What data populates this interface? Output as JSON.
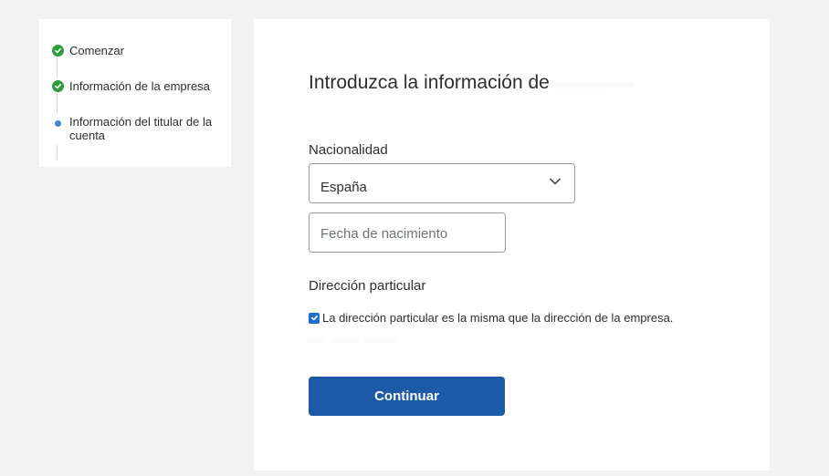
{
  "steps": {
    "items": [
      {
        "label": "Comenzar",
        "status": "complete"
      },
      {
        "label": "Información de la empresa",
        "status": "complete"
      },
      {
        "label": "Información del titular de la cuenta",
        "status": "active"
      }
    ],
    "complete_icon": "check-circle-icon",
    "active_icon": "dot-icon"
  },
  "form": {
    "title_prefix": "Introduzca la información de",
    "title_redacted": "············",
    "nationality": {
      "label": "Nacionalidad",
      "value": "España",
      "icon": "chevron-down-icon"
    },
    "birthdate": {
      "placeholder": "Fecha de nacimiento",
      "value": ""
    },
    "home_address": {
      "label": "Dirección particular",
      "same_as_business_checked": true,
      "same_as_business_label": "La dirección particular es la misma que la dirección de la empresa.",
      "redacted_address": "··· ····· ······"
    },
    "continue_label": "Continuar"
  },
  "colors": {
    "background": "#f2f2f2",
    "card": "#ffffff",
    "primary_button": "#1c5aa8",
    "checkbox": "#1f6fd1",
    "step_complete": "#2d9d3a",
    "step_active": "#3a87d8"
  }
}
